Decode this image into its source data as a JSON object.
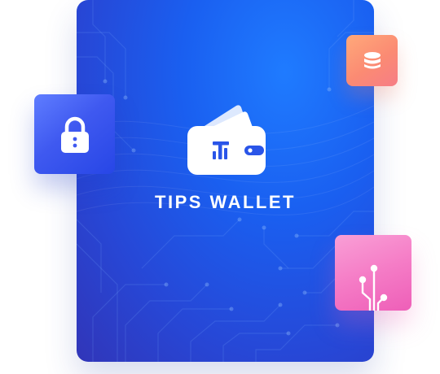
{
  "brand": {
    "title": "TIPS WALLET"
  },
  "icons": {
    "wallet": "wallet-icon",
    "lock": "lock-icon",
    "database": "database-icon",
    "circuit": "circuit-icon"
  },
  "colors": {
    "card_blue": "#1a5ff0",
    "lock_tile": "#3f59f0",
    "database_tile": "#fb8b73",
    "circuit_tile": "#f57cc6",
    "text": "#ffffff"
  }
}
